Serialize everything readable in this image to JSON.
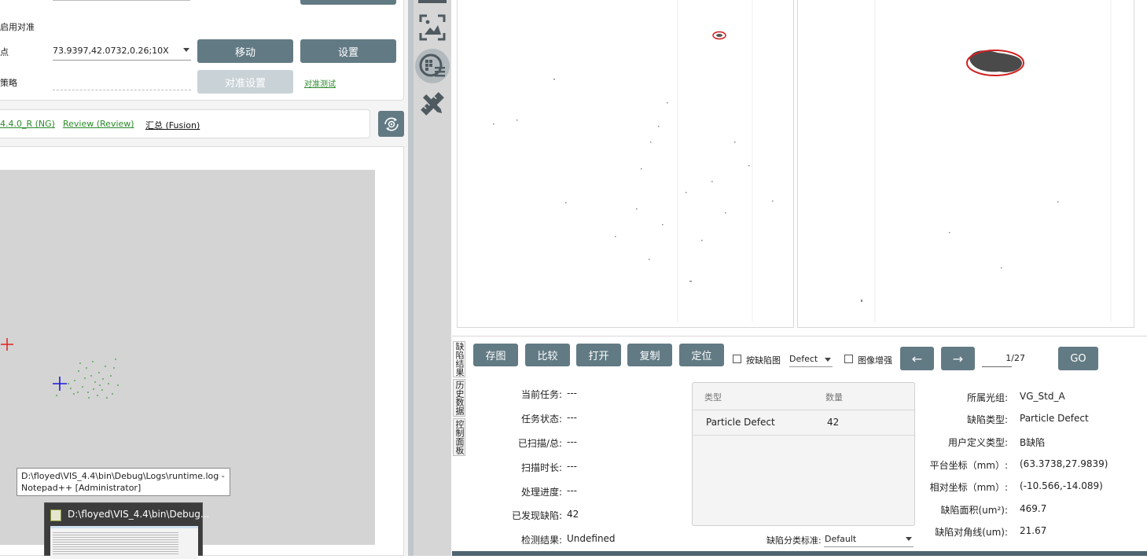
{
  "calibration": {
    "enable_label": "启用对准",
    "point_label": "点",
    "point_value": "73.9397,42.0732,0.26;10X",
    "strategy_label": "策略",
    "move_button": "移动",
    "set_button": "设置",
    "align_settings_button": "对准设置",
    "align_test_link": "对准测试"
  },
  "tabs": {
    "tab1": "4.4.0_R (NG)",
    "tab2": "Review (Review)",
    "tab3": "汇总 (Fusion)"
  },
  "taskbar": {
    "tooltip_line1": "D:\\floyed\\VIS_4.4\\bin\\Debug\\Logs\\runtime.log -",
    "tooltip_line2": "Notepad++ [Administrator]",
    "preview_title": "D:\\floyed\\VIS_4.4\\bin\\Debug..."
  },
  "vertical_tabs": {
    "defect_result": "缺陷结果",
    "history_data": "历史数据",
    "control_panel": "控制面板"
  },
  "toolbar": {
    "save_image": "存图",
    "compare": "比较",
    "open": "打开",
    "copy": "复制",
    "locate": "定位",
    "by_defect_map": "按缺陷图",
    "defect_select": "Defect",
    "image_enhance": "图像增强",
    "prev_arrow": "←",
    "next_arrow": "→",
    "page_value": "1/27",
    "go_button": "GO"
  },
  "task_info": {
    "current_task_label": "当前任务:",
    "current_task_value": "---",
    "task_status_label": "任务状态:",
    "task_status_value": "---",
    "scanned_label": "已扫描/总:",
    "scanned_value": "---",
    "scan_time_label": "扫描时长:",
    "scan_time_value": "---",
    "progress_label": "处理进度:",
    "progress_value": "---",
    "found_defects_label": "已发现缺陷:",
    "found_defects_value": "42",
    "detect_result_label": "检测结果:",
    "detect_result_value": "Undefined"
  },
  "defect_table": {
    "col_type": "类型",
    "col_count": "数量",
    "rows": [
      {
        "type": "Particle Defect",
        "count": "42"
      }
    ],
    "classify_label": "缺陷分类标准:",
    "classify_value": "Default"
  },
  "defect_detail": {
    "group_label": "所属光组:",
    "group_value": "VG_Std_A",
    "type_label": "缺陷类型:",
    "type_value": "Particle Defect",
    "user_type_label": "用户定义类型:",
    "user_type_value": "B缺陷",
    "stage_coord_label": "平台坐标（mm）:",
    "stage_coord_value": "(63.3738,27.9839)",
    "rel_coord_label": "相对坐标（mm）:",
    "rel_coord_value": "(-10.566,-14.089)",
    "area_label": "缺陷面积(um²):",
    "area_value": "469.7",
    "diag_label": "缺陷对角线(um):",
    "diag_value": "21.67"
  },
  "colors": {
    "button": "#627a84",
    "button_disabled": "#c9d3d7",
    "link_green": "#2a8a2a",
    "map_bg": "#d4d4d4",
    "sidebar": "#d6d6d6"
  }
}
